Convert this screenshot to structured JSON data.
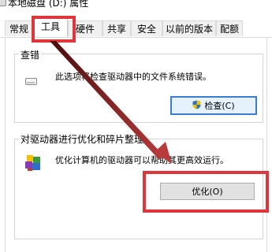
{
  "window": {
    "title": "本地磁盘 (D:) 属性"
  },
  "tabs": [
    {
      "label": "常规"
    },
    {
      "label": "工具",
      "active": true
    },
    {
      "label": "硬件"
    },
    {
      "label": "共享"
    },
    {
      "label": "安全"
    },
    {
      "label": "以前的版本"
    },
    {
      "label": "配额"
    }
  ],
  "error_checking": {
    "title": "查错",
    "description": "此选项将检查驱动器中的文件系统错误。",
    "button_label": "检查(C)",
    "icon": "drive-icon"
  },
  "optimize": {
    "title": "对驱动器进行优化和碎片整理",
    "description": "优化计算机的驱动器可以帮助其更高效运行。",
    "button_label": "优化(O)",
    "icon": "defrag-icon"
  },
  "annotations": {
    "highlight_color": "#e0353a",
    "arrow_color": "#8b1a1a"
  }
}
